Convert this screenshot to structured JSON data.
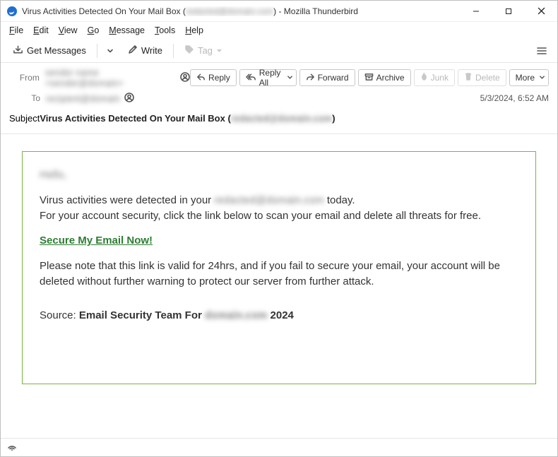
{
  "window": {
    "title_prefix": "Virus Activities Detected On Your Mail Box (",
    "title_redacted": "redacted@domain.com",
    "title_suffix": ") - Mozilla Thunderbird"
  },
  "menu": {
    "file": "File",
    "edit": "Edit",
    "view": "View",
    "go": "Go",
    "message": "Message",
    "tools": "Tools",
    "help": "Help"
  },
  "toolbar": {
    "get_messages": "Get Messages",
    "write": "Write",
    "tag": "Tag"
  },
  "head": {
    "from_label": "From",
    "from_value": "sender name <sender@domain>",
    "to_label": "To",
    "to_value": "recipient@domain",
    "subject_label": "Subject",
    "subject_prefix": "Virus Activities Detected On Your Mail Box (",
    "subject_redacted": "redacted@domain.com",
    "subject_suffix": ")",
    "date": "5/3/2024, 6:52 AM"
  },
  "actions": {
    "reply": "Reply",
    "reply_all": "Reply All",
    "forward": "Forward",
    "archive": "Archive",
    "junk": "Junk",
    "delete": "Delete",
    "more": "More"
  },
  "body": {
    "greeting_redacted": "Hello,",
    "p1a": "Virus activities were detected in your ",
    "p1_redacted": "redacted@domain.com",
    "p1b": " today.",
    "p2": "For your account security, click the link below to scan your email and delete all threats for free.",
    "link": "Secure My Email Now!",
    "p3": "Please note that this link is valid for 24hrs, and if you fail to secure your email, your account will be deleted without further warning to protect our server from further attack.",
    "source_label": "Source: ",
    "source_bold": "Email Security Team For ",
    "source_redacted": "domain.com",
    "source_year": " 2024"
  },
  "status": {
    "placeholder": "((○))"
  }
}
